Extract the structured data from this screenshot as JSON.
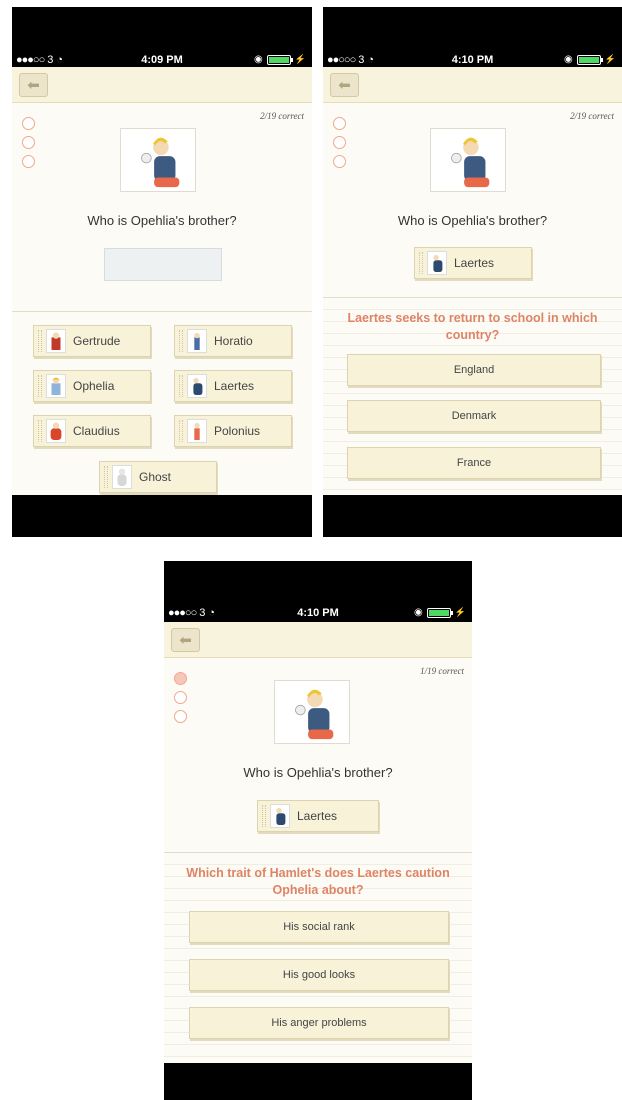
{
  "status_bar": {
    "carrier": "3",
    "battery_color": "#4cd964"
  },
  "screens": [
    {
      "time": "4:09 PM",
      "score": "2/19 correct",
      "progress_filled": [
        false,
        false,
        false
      ],
      "question": "Who is Opehlia's brother?",
      "choices": [
        "Gertrude",
        "Horatio",
        "Ophelia",
        "Laertes",
        "Claudius",
        "Polonius",
        "Ghost"
      ]
    },
    {
      "time": "4:10 PM",
      "score": "2/19 correct",
      "progress_filled": [
        false,
        false,
        false
      ],
      "question": "Who is Opehlia's brother?",
      "selected_answer": "Laertes",
      "followup_question": "Laertes seeks to return to school in which country?",
      "options": [
        "England",
        "Denmark",
        "France"
      ]
    },
    {
      "time": "4:10 PM",
      "score": "1/19 correct",
      "progress_filled": [
        true,
        false,
        false
      ],
      "question": "Who is Opehlia's brother?",
      "selected_answer": "Laertes",
      "followup_question": "Which trait of Hamlet's does Laertes caution Ophelia about?",
      "options": [
        "His social rank",
        "His good looks",
        "His anger problems"
      ]
    }
  ],
  "icons": {
    "back": "left-arrow-icon",
    "wifi": "wifi-icon",
    "rotation_lock": "rotation-lock-icon",
    "charging": "bolt-icon"
  },
  "colors": {
    "accent_title": "#de8465",
    "progress_ring": "#f0a890",
    "button_bg": "#f8f2d9",
    "navbar_bg": "#f8f3dc"
  }
}
